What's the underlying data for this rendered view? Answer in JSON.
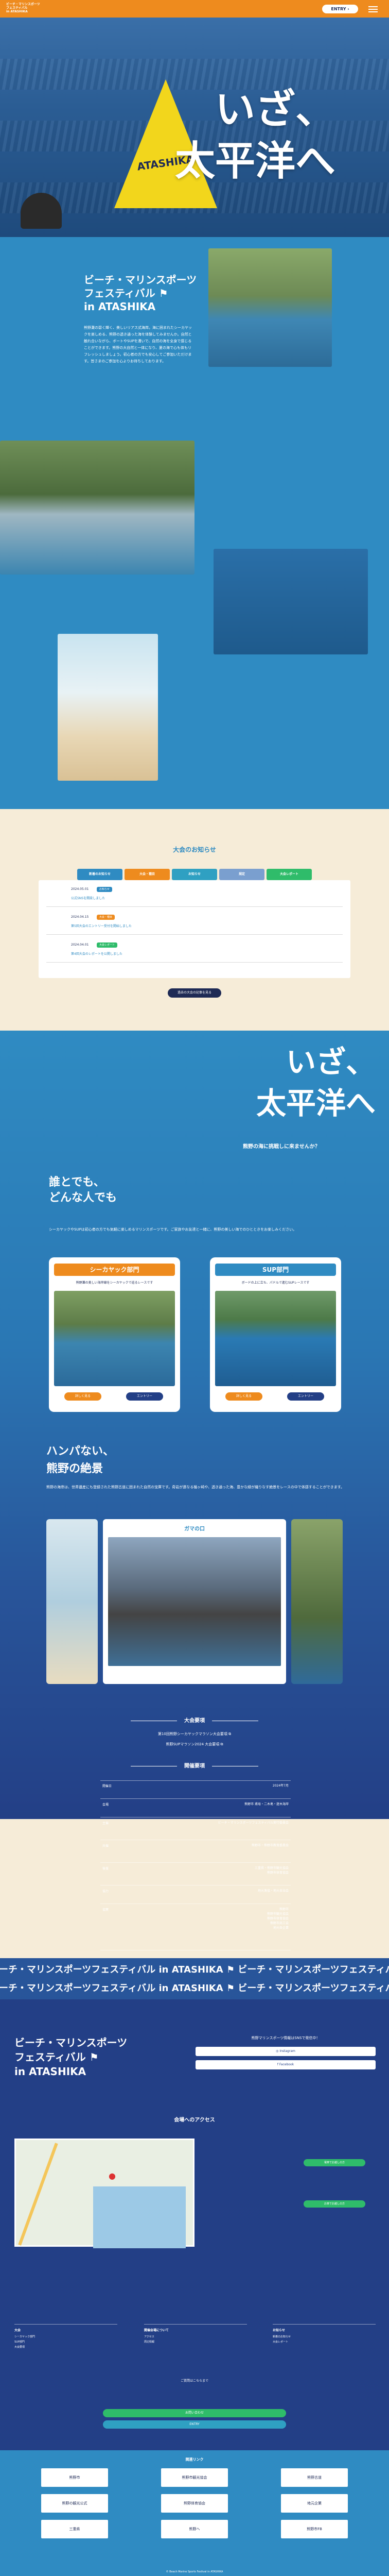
{
  "header": {
    "logo": [
      "ビーチ・マリンスポーツ",
      "フェスティバル",
      "in ATASHIKA"
    ],
    "entry": "ENTRY",
    "entry_icon": "chevron-right-icon",
    "menu_icon": "hamburger-menu-icon"
  },
  "hero": {
    "title_line1": "いざ、",
    "title_line2": "太平洋へ",
    "buoy_text": "ATASHIKA"
  },
  "intro": {
    "title": [
      "ビーチ・マリンスポーツ",
      "フェスティバル",
      "in ATASHIKA"
    ],
    "body": "熊野灘の碧く輝く、美しいリアス式海岸。海に囲まれたシーカヤックを楽しめる、熊野の透き通った海を体験してみませんか。自然と触れ合いながら、ボートやSUPを漕いで、自然の海を全身で感じることができます。熊野の大自然と一体になり、夏の海で心も体もリフレッシュしましょう。初心者の方でも安心してご参加いただけます。皆さまのご参加を心よりお待ちしております。"
  },
  "news": {
    "title": "大会のお知らせ",
    "tabs": [
      "新着のお知らせ",
      "大会・種目",
      "お知らせ",
      "規定",
      "大会レポート"
    ],
    "tab_colors": [
      "#2f8bc2",
      "#ee8b1e",
      "#2f8bc2",
      "#7a9fcf",
      "#2fbc6a"
    ],
    "items": [
      {
        "date": "2024.05.01",
        "badge": "お知らせ",
        "badge_color": "#2f8bc2",
        "title": "公式SNSを開設しました"
      },
      {
        "date": "2024.04.15",
        "badge": "大会・種目",
        "badge_color": "#ee8b1e",
        "title": "第5回大会のエントリー受付を開始しました"
      },
      {
        "date": "2024.04.01",
        "badge": "大会レポート",
        "badge_color": "#2fbc6a",
        "title": "第4回大会のレポートを公開しました"
      }
    ],
    "more": "過去の大会の記事を見る"
  },
  "events": {
    "title_line1": "いざ、",
    "title_line2": "太平洋へ",
    "ask": "熊野の海に挑戦しに来ませんか？",
    "anyone_line1": "誰とでも、",
    "anyone_line2": "どんな人でも",
    "anyone_body": "シーカヤックやSUPは初心者の方でも気軽に楽しめるマリンスポーツです。ご家族やお友達と一緒に、熊野の美しい海でのひとときをお楽しみください。",
    "cards": [
      {
        "title": "シーカヤック部門",
        "color": "#ee8b1e",
        "desc": "熊野灘の美しい海岸線をシーカヤックで巡るレースです",
        "btn1": "詳しく見る",
        "btn2": "エントリー"
      },
      {
        "title": "SUP部門",
        "color": "#2f8bc2",
        "desc": "ボードの上に立ち、パドルで進むSUPレースです",
        "btn1": "詳しく見る",
        "btn2": "エントリー"
      }
    ],
    "hanpa_line1": "ハンパない、",
    "hanpa_line2": "熊野の絶景",
    "hanpa_body": "熊野の海岸は、世界遺産にも登録された熊野古道に囲まれた自然の宝庫です。奇岩が連なる楯ヶ崎や、透き通った海、豊かな緑が織りなす絶景をレースの中で体感することができます。",
    "slide_title": "ガマの口",
    "slide_dots": "● ● ● ● ●"
  },
  "summary": {
    "title": "大会要項",
    "prize1": "第10回熊野シーカヤックマラソン大会要項",
    "prize2": "熊野SUPマラソン2024 大会要項",
    "outline_title": "開催要項",
    "rows": [
      {
        "k": "開催日",
        "v": "2024年7月"
      },
      {
        "k": "会場",
        "v": "熊野市 甫母・二木島・遊木海岸"
      },
      {
        "k": "主催",
        "v": "ビーチ・マリンスポーツフェスティバル実行委員会"
      },
      {
        "k": "共催",
        "v": "熊野市・熊野市教育委員会"
      },
      {
        "k": "後援",
        "v": "三重県・熊野市観光協会\n熊野市体育協会"
      },
      {
        "k": "協力",
        "v": "地元漁協・地元自治会"
      },
      {
        "k": "協賛",
        "v": "熊野市\n熊野市観光協会\n熊野市体育協会\n熊野市商工会\n地元各企業"
      }
    ]
  },
  "marquee": {
    "text": "ビーチ・マリンスポーツフェスティバル in ATASHIKA"
  },
  "footer": {
    "follow": "熊野マリンスポーツ情報はSNSで発信中！",
    "sns": [
      "Instagram",
      "Facebook"
    ],
    "access_title": "会場へのアクセス",
    "access_btns": [
      "電車でお越しの方",
      "お車でお越しの方"
    ],
    "cols": [
      {
        "h": "大会",
        "links": [
          "シーカヤック部門",
          "SUP部門",
          "大会要項"
        ]
      },
      {
        "h": "開催会場について",
        "links": [
          "アクセス",
          "周辺情報"
        ]
      },
      {
        "h": "お知らせ",
        "links": [
          "新着のお知らせ",
          "大会レポート"
        ]
      }
    ],
    "contact": "ご質問はこちらまで",
    "pills": [
      "お問い合わせ",
      "ENTRY"
    ],
    "sponsor_title": "関連リンク",
    "sponsors": [
      "熊野市",
      "熊野市観光協会",
      "熊野古道",
      "熊野の観光公式",
      "熊野体育協会",
      "地元企業",
      "三重県",
      "熊野へ",
      "熊野市FB"
    ],
    "copyright": "© Beach Marine Sports Festival in ATASHIKA"
  }
}
